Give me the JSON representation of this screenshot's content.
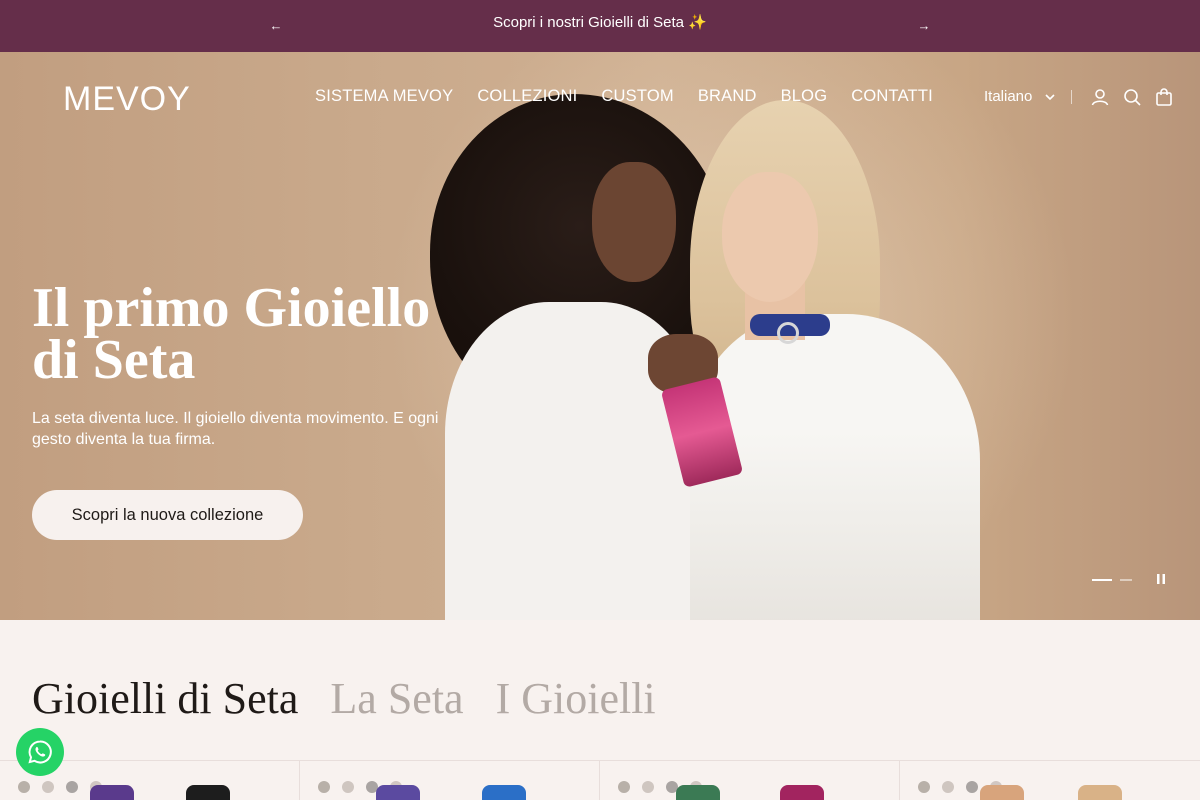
{
  "announcement": {
    "message": "Scopri i nostri Gioielli di Seta ✨",
    "prev_icon": "←",
    "next_icon": "→",
    "background": "#652e4a"
  },
  "header": {
    "logo": "MEVOY",
    "nav": [
      "SISTEMA MEVOY",
      "COLLEZIONI",
      "CUSTOM",
      "BRAND",
      "BLOG",
      "CONTATTI"
    ],
    "language": "Italiano",
    "icons": [
      "account-icon",
      "search-icon",
      "cart-icon"
    ]
  },
  "hero": {
    "title": "Il primo Gioiello di Seta",
    "subtitle": "La seta diventa luce. Il gioiello diventa movimento. E ogni gesto diventa la tua firma.",
    "cta": "Scopri la nuova collezione",
    "slides_total": 2,
    "slide_active": 1
  },
  "section": {
    "tabs": [
      {
        "label": "Gioielli di Seta",
        "active": true
      },
      {
        "label": "La Seta",
        "active": false
      },
      {
        "label": "I Gioielli",
        "active": false
      }
    ]
  },
  "products": {
    "count_visible": 4,
    "peek_colors": [
      [
        "#5a3a8c",
        "#1d1d1d"
      ],
      [
        "#5b4aa0",
        "#2b6fc7"
      ],
      [
        "#3b7a54",
        "#a2245f"
      ],
      [
        "#d8a47c",
        "#d9b287"
      ]
    ]
  },
  "colors": {
    "accent": "#652e4a",
    "page_bg": "#f8f2ef",
    "whatsapp": "#25d366"
  }
}
